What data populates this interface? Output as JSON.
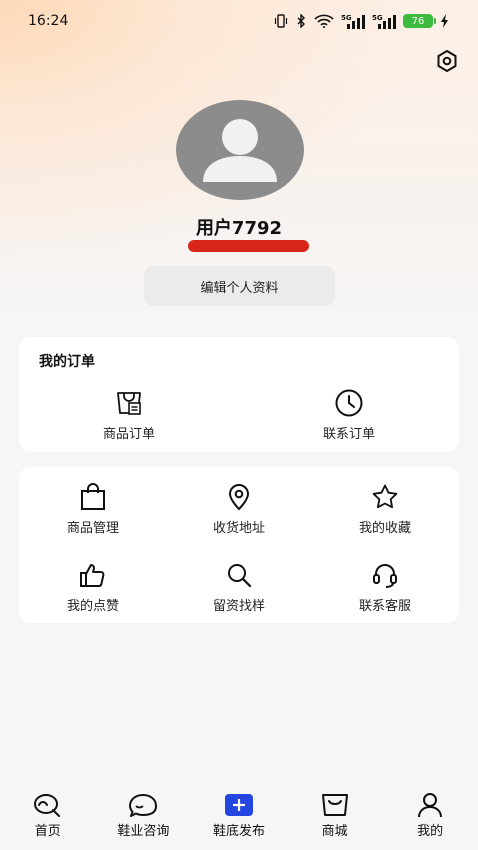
{
  "status_bar": {
    "time": "16:24",
    "battery": "76",
    "network_1": "5G",
    "network_2": "5G"
  },
  "profile": {
    "username": "用户7792",
    "edit_button": "编辑个人资料"
  },
  "orders": {
    "title": "我的订单",
    "items": [
      {
        "label": "商品订单",
        "icon": "shopping-bag-list-icon"
      },
      {
        "label": "联系订单",
        "icon": "clock-icon"
      }
    ]
  },
  "tools": {
    "items": [
      {
        "label": "商品管理",
        "icon": "bag-icon"
      },
      {
        "label": "收货地址",
        "icon": "location-pin-icon"
      },
      {
        "label": "我的收藏",
        "icon": "star-icon"
      },
      {
        "label": "我的点赞",
        "icon": "thumbs-up-icon"
      },
      {
        "label": "留资找样",
        "icon": "search-icon"
      },
      {
        "label": "联系客服",
        "icon": "headset-icon"
      }
    ]
  },
  "tabbar": {
    "tabs": [
      {
        "label": "首页",
        "icon": "home-icon"
      },
      {
        "label": "鞋业咨询",
        "icon": "chat-bubble-icon"
      },
      {
        "label": "鞋底发布",
        "icon": "plus-icon"
      },
      {
        "label": "商城",
        "icon": "shop-bag-icon"
      },
      {
        "label": "我的",
        "icon": "person-icon"
      }
    ],
    "active_color": "#2345e0"
  },
  "colors": {
    "accent_red": "#d8261a",
    "avatar_gray": "#8c8c8c"
  }
}
